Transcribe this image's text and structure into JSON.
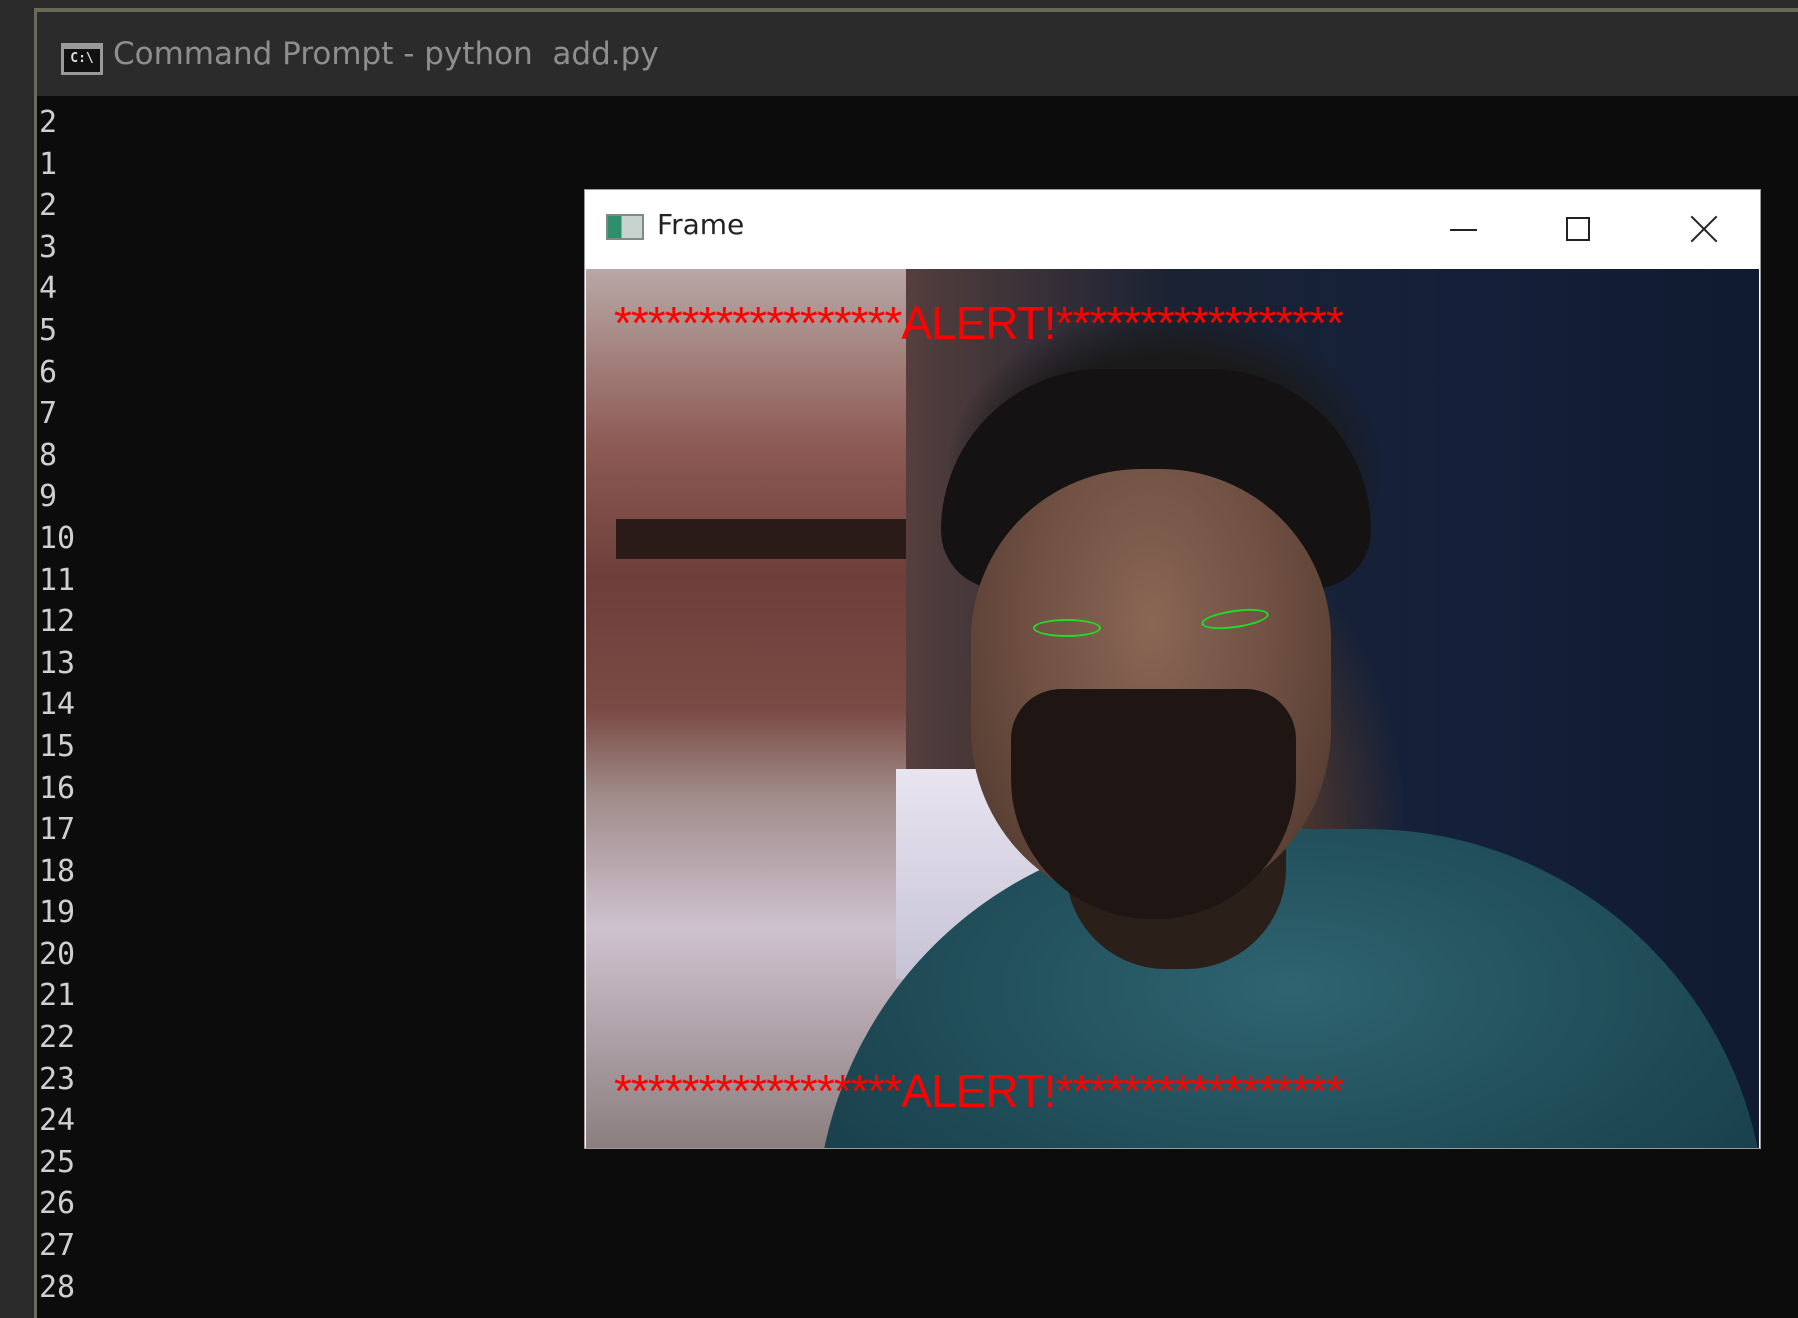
{
  "cmd": {
    "title": "Command Prompt - python  add.py",
    "icon_text": "C:\\",
    "lines": [
      "2",
      "1",
      "2",
      "3",
      "4",
      "5",
      "6",
      "7",
      "8",
      "9",
      "10",
      "11",
      "12",
      "13",
      "14",
      "15",
      "16",
      "17",
      "18",
      "19",
      "20",
      "21",
      "22",
      "23",
      "24",
      "25",
      "26",
      "27",
      "28"
    ]
  },
  "frame": {
    "title": "Frame",
    "alert_top": "*****************ALERT!*****************",
    "alert_bottom": "*****************ALERT!*****************",
    "alert_color": "#ff0000",
    "eye_contour_color": "#1fdc28"
  }
}
